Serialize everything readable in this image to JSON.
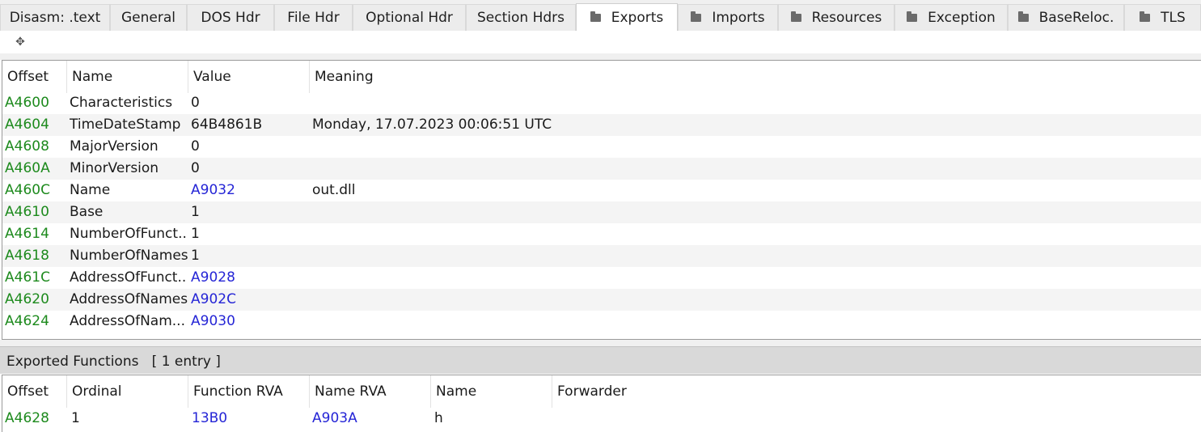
{
  "tabs": [
    {
      "label": "Disasm: .text",
      "folder": false,
      "active": false
    },
    {
      "label": "General",
      "folder": false,
      "active": false
    },
    {
      "label": "DOS Hdr",
      "folder": false,
      "active": false
    },
    {
      "label": "File Hdr",
      "folder": false,
      "active": false
    },
    {
      "label": "Optional Hdr",
      "folder": false,
      "active": false
    },
    {
      "label": "Section Hdrs",
      "folder": false,
      "active": false
    },
    {
      "label": "Exports",
      "folder": true,
      "active": true
    },
    {
      "label": "Imports",
      "folder": true,
      "active": false
    },
    {
      "label": "Resources",
      "folder": true,
      "active": false
    },
    {
      "label": "Exception",
      "folder": true,
      "active": false
    },
    {
      "label": "BaseReloc.",
      "folder": true,
      "active": false
    },
    {
      "label": "TLS",
      "folder": true,
      "active": false
    }
  ],
  "toolbar": {
    "move_icon": "✥"
  },
  "exports_table": {
    "headers": [
      "Offset",
      "Name",
      "Value",
      "Meaning"
    ],
    "rows": [
      {
        "offset": "A4600",
        "name": "Characteristics",
        "value": "0",
        "meaning": "",
        "value_link": false
      },
      {
        "offset": "A4604",
        "name": "TimeDateStamp",
        "value": "64B4861B",
        "meaning": "Monday, 17.07.2023 00:06:51 UTC",
        "value_link": false
      },
      {
        "offset": "A4608",
        "name": "MajorVersion",
        "value": "0",
        "meaning": "",
        "value_link": false
      },
      {
        "offset": "A460A",
        "name": "MinorVersion",
        "value": "0",
        "meaning": "",
        "value_link": false
      },
      {
        "offset": "A460C",
        "name": "Name",
        "value": "A9032",
        "meaning": "out.dll",
        "value_link": true
      },
      {
        "offset": "A4610",
        "name": "Base",
        "value": "1",
        "meaning": "",
        "value_link": false
      },
      {
        "offset": "A4614",
        "name": "NumberOfFunct...",
        "value": "1",
        "meaning": "",
        "value_link": false
      },
      {
        "offset": "A4618",
        "name": "NumberOfNames",
        "value": "1",
        "meaning": "",
        "value_link": false
      },
      {
        "offset": "A461C",
        "name": "AddressOfFunct...",
        "value": "A9028",
        "meaning": "",
        "value_link": true
      },
      {
        "offset": "A4620",
        "name": "AddressOfNames",
        "value": "A902C",
        "meaning": "",
        "value_link": true
      },
      {
        "offset": "A4624",
        "name": "AddressOfNam...",
        "value": "A9030",
        "meaning": "",
        "value_link": true
      }
    ]
  },
  "exported_functions": {
    "caption": "Exported Functions   [ 1 entry ]",
    "headers": [
      "Offset",
      "Ordinal",
      "Function RVA",
      "Name RVA",
      "Name",
      "Forwarder"
    ],
    "rows": [
      {
        "offset": "A4628",
        "ordinal": "1",
        "function_rva": "13B0",
        "name_rva": "A903A",
        "name": "h",
        "forwarder": ""
      }
    ]
  },
  "colors": {
    "offset": "#1d8a1d",
    "link": "#2525d6"
  }
}
